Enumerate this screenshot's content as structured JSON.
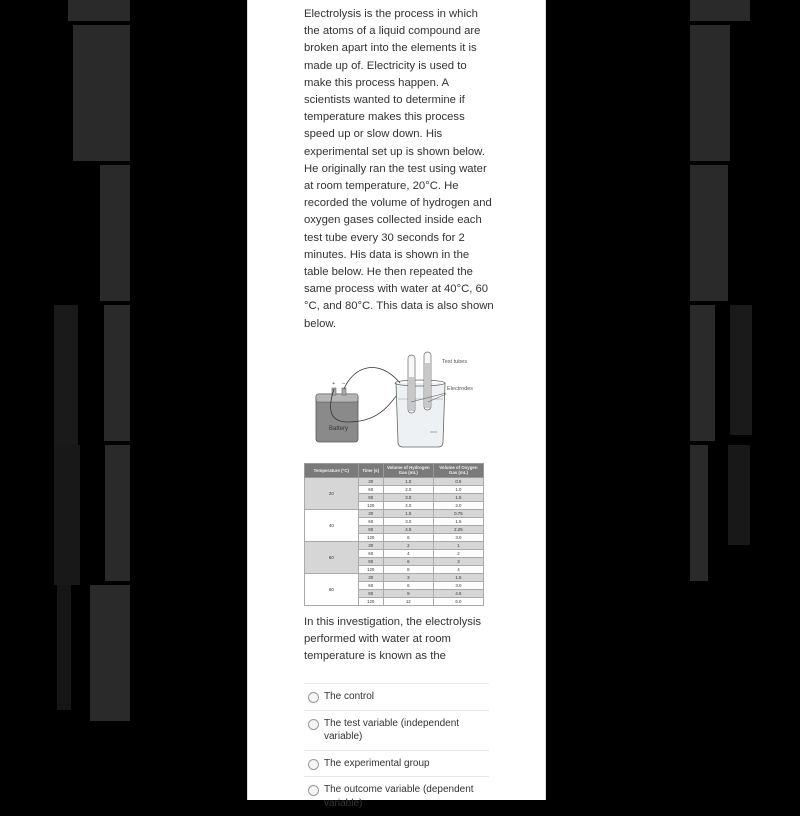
{
  "passage": "Electrolysis is the process in which the atoms of a liquid compound are broken apart into the elements it is made up of.  Electricity is used to make this process happen.  A scientists wanted to determine if temperature makes this process speed up or slow down.  His experimental set up is shown below.  He originally ran the test using water at room temperature, 20°C.  He recorded the volume of hydrogen and oxygen gases collected inside each test tube every 30 seconds for 2 minutes.  His data is shown in the table below.  He then repeated the same process with water at 40°C, 60 °C, and 80°C.  This data is also shown below.",
  "figure": {
    "battery_label": "Battery",
    "test_tubes_label": "Test tubes",
    "electrodes_label": "Electrodes",
    "plus": "+",
    "minus": "–"
  },
  "table": {
    "headers": [
      "Temperature (°C)",
      "Time (s)",
      "Volume of Hydrogen Gas (mL)",
      "Volume of Oxygen Gas (mL)"
    ],
    "groups": [
      {
        "temp": "20",
        "rows": [
          [
            "30",
            "1.0",
            "0.5"
          ],
          [
            "60",
            "2.0",
            "1.0"
          ],
          [
            "90",
            "3.0",
            "1.5"
          ],
          [
            "120",
            "4.0",
            "2.0"
          ]
        ]
      },
      {
        "temp": "40",
        "rows": [
          [
            "30",
            "1.5",
            "0.75"
          ],
          [
            "60",
            "3.0",
            "1.5"
          ],
          [
            "90",
            "4.5",
            "2.25"
          ],
          [
            "120",
            "6",
            "3.0"
          ]
        ]
      },
      {
        "temp": "60",
        "rows": [
          [
            "30",
            "2",
            "1"
          ],
          [
            "60",
            "4",
            "2"
          ],
          [
            "90",
            "6",
            "3"
          ],
          [
            "120",
            "8",
            "4"
          ]
        ]
      },
      {
        "temp": "80",
        "rows": [
          [
            "30",
            "3",
            "1.5"
          ],
          [
            "60",
            "6",
            "3.0"
          ],
          [
            "90",
            "9",
            "4.5"
          ],
          [
            "120",
            "12",
            "6.0"
          ]
        ]
      }
    ]
  },
  "question": "In this investigation, the electrolysis performed with water at room temperature is known as the",
  "options": [
    {
      "label": "The control",
      "selected": false
    },
    {
      "label": "The test variable (independent variable)",
      "selected": false
    },
    {
      "label": "The experimental group",
      "selected": false
    },
    {
      "label": "The outcome variable (dependent variable)",
      "selected": false
    }
  ]
}
